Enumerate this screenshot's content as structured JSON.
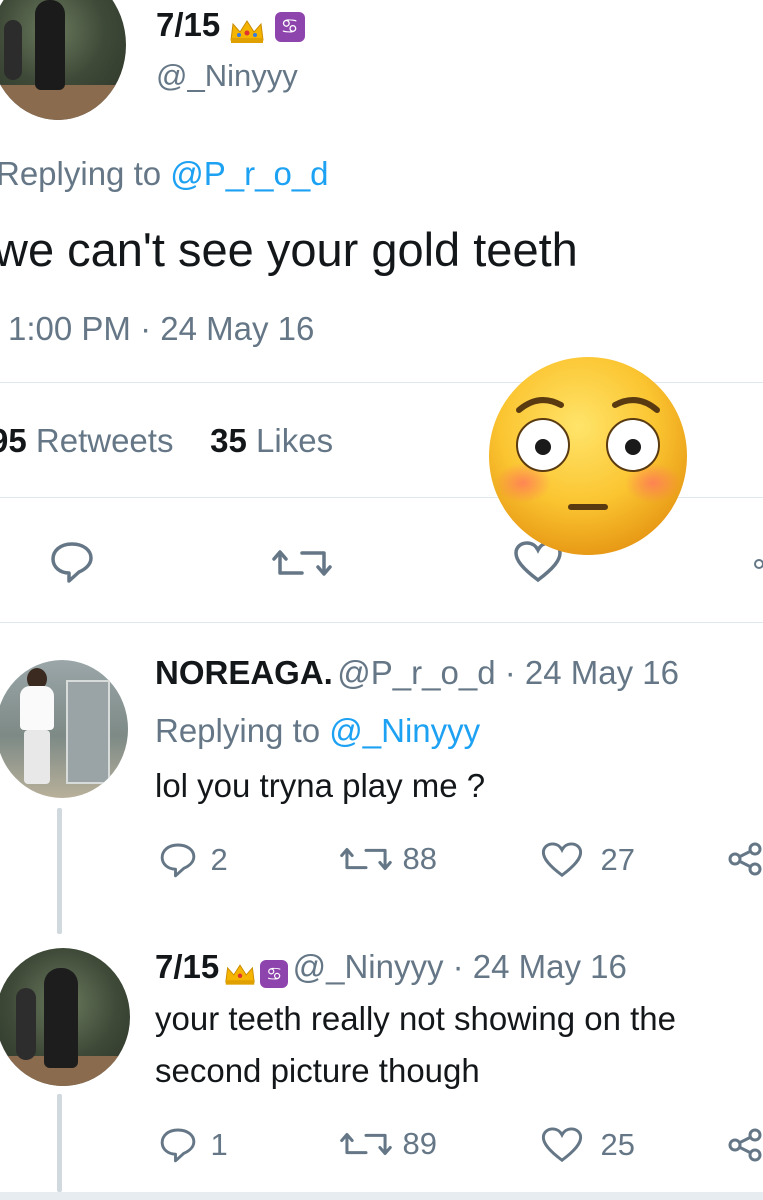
{
  "main_tweet": {
    "display_name": "7/15",
    "handle": "@_Ninyyy",
    "badges": [
      "crown-emoji",
      "cancer-zodiac-emoji"
    ],
    "replying_label": "Replying to ",
    "replying_to": "@P_r_o_d",
    "text": "we can't see your gold teeth",
    "timestamp": "1:00 PM · 24 May 16",
    "retweets_count": "95",
    "retweets_label": "Retweets",
    "likes_count": "35",
    "likes_label": "Likes"
  },
  "overlay": {
    "emoji": "flushed-face-emoji"
  },
  "replies": [
    {
      "display_name": "NOREAGA.",
      "meta": "@P_r_o_d · 24 May 16",
      "replying_label": "Replying to ",
      "replying_to": "@_Ninyyy",
      "text": "lol you tryna play me ?",
      "reply_count": "2",
      "retweet_count": "88",
      "like_count": "27"
    },
    {
      "display_name": "7/15",
      "meta": "@_Ninyyy · 24 May 16",
      "text_line1": "your teeth really not showing on the",
      "text_line2": "second picture though",
      "reply_count": "1",
      "retweet_count": "89",
      "like_count": "25"
    }
  ],
  "colors": {
    "link": "#1da1f2",
    "secondary": "#657786",
    "primary_text": "#14171a",
    "divider": "#e1e8ed"
  }
}
